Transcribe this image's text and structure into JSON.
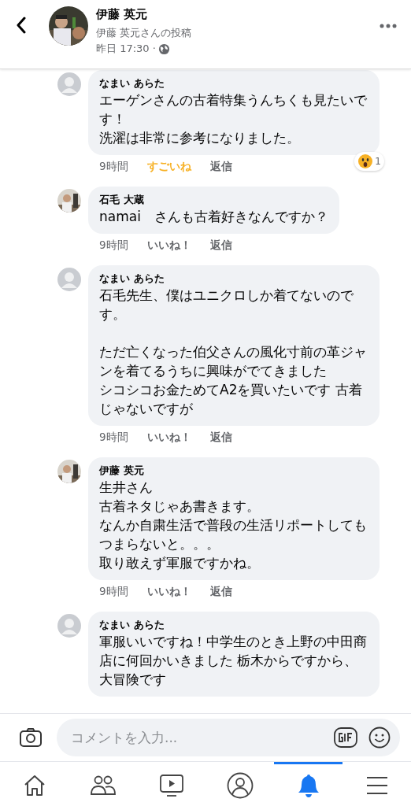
{
  "header": {
    "name": "伊藤 英元",
    "subtitle": "伊藤 英元さんの投稿",
    "time": "昨日 17:30 ·"
  },
  "comments": [
    {
      "author": "なまい あらた",
      "kind": "default",
      "blocks": [
        [
          "エーゲンさんの古着特集うんちくも見たいです！",
          "洗濯は非常に参考になりました。"
        ]
      ],
      "time": "9時間",
      "like": "すごいね",
      "reacted": true,
      "reaction_count": "1",
      "reply": "返信"
    },
    {
      "author": "石毛 大蔵",
      "blocks": [
        [
          "namai　さんも古着好きなんですか？"
        ]
      ],
      "time": "9時間",
      "like": "いいね！",
      "reacted": false,
      "reply": "返信"
    },
    {
      "author": "なまい あらた",
      "kind": "default",
      "blocks": [
        [
          "石毛先生、僕はユニクロしか着てないのです。"
        ],
        [
          "ただ亡くなった伯父さんの風化寸前の革ジャンを着てるうちに興味がでてきました",
          "シコシコお金ためてA2を買いたいです 古着じゃないですが"
        ]
      ],
      "time": "9時間",
      "like": "いいね！",
      "reacted": false,
      "reply": "返信"
    },
    {
      "author": "伊藤 英元",
      "blocks": [
        [
          "生井さん",
          "古着ネタじゃあ書きます。",
          "なんか自粛生活で普段の生活リポートしてもつまらないと。。。",
          "取り敢えず軍服ですかね。"
        ]
      ],
      "time": "9時間",
      "like": "いいね！",
      "reacted": false,
      "reply": "返信"
    },
    {
      "author": "なまい あらた",
      "kind": "default",
      "blocks": [
        [
          "軍服いいですね！中学生のとき上野の中田商店に何回かいきました 栃木からですから、大冒険です"
        ]
      ]
    }
  ],
  "composer": {
    "placeholder": "コメントを入力..."
  },
  "tabs": [
    {
      "kind": "home",
      "selected": false
    },
    {
      "kind": "friends",
      "selected": false
    },
    {
      "kind": "video",
      "selected": false
    },
    {
      "kind": "profile",
      "selected": false
    },
    {
      "kind": "notifications",
      "selected": true
    },
    {
      "kind": "menu",
      "selected": false
    }
  ]
}
